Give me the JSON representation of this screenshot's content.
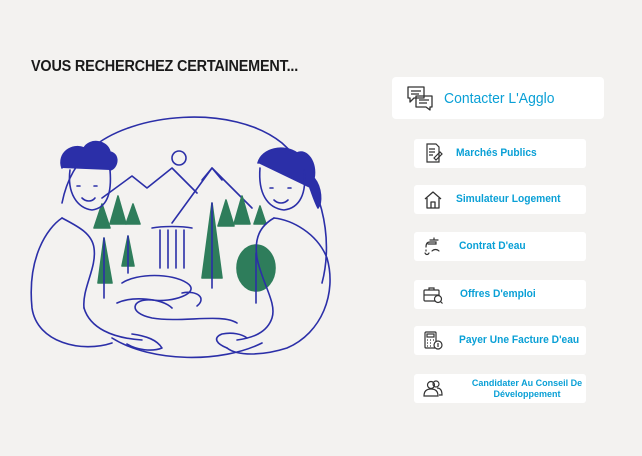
{
  "section": {
    "title": "VOUS RECHERCHEZ CERTAINEMENT..."
  },
  "primary_link": {
    "label": "Contacter L'Agglo",
    "icon": "chat-bubbles-icon"
  },
  "links": [
    {
      "label": "Marchés Publics",
      "icon": "document-stamp-icon"
    },
    {
      "label": "Simulateur Logement",
      "icon": "house-icon"
    },
    {
      "label": "Contrat D'eau",
      "icon": "water-tap-icon"
    },
    {
      "label": "Offres D'emploi",
      "icon": "briefcase-search-icon"
    },
    {
      "label": "Payer Une Facture D'eau",
      "icon": "calculator-coin-icon"
    },
    {
      "label": "Candidater Au Conseil De Développement",
      "icon": "people-icon"
    }
  ],
  "colors": {
    "background": "#f3f2f0",
    "accent": "#0aa0d6",
    "illustration_stroke": "#2b2fa8",
    "illustration_green": "#2e7d5b",
    "icon_stroke": "#333333"
  }
}
